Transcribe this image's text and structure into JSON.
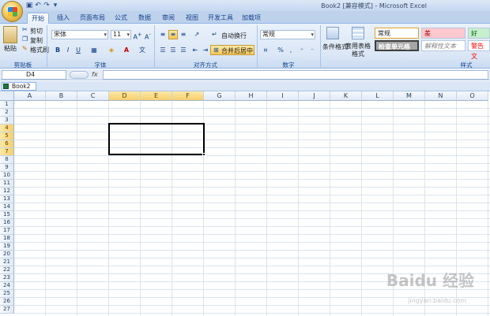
{
  "titlebar": {
    "title": "Book2  [兼容模式] - Microsoft Excel"
  },
  "tabs": [
    "开始",
    "插入",
    "页面布局",
    "公式",
    "数据",
    "审阅",
    "视图",
    "开发工具",
    "加载项"
  ],
  "clipboard": {
    "paste": "粘贴",
    "cut": "剪切",
    "copy": "复制",
    "format_painter": "格式刷",
    "group": "剪贴板"
  },
  "font": {
    "name": "宋体",
    "size": "11",
    "group": "字体",
    "bold": "B",
    "italic": "I",
    "underline": "U"
  },
  "alignment": {
    "wrap": "自动换行",
    "merge": "合并后居中",
    "group": "对齐方式"
  },
  "number": {
    "format": "常规",
    "percent": "%",
    "comma": ",",
    "group": "数字"
  },
  "styles": {
    "conditional": "条件格式",
    "table_format": "套用表格格式",
    "normal": "常规",
    "bad": "差",
    "good": "好",
    "check_cell": "检查单元格",
    "explanatory": "解释性文本",
    "warning": "警告文",
    "group": "样式"
  },
  "formula_bar": {
    "name_box": "D4",
    "fx": "fx",
    "content": ""
  },
  "workbook_tab": "Book2",
  "columns": [
    "A",
    "B",
    "C",
    "D",
    "E",
    "F",
    "G",
    "H",
    "I",
    "J",
    "K",
    "L",
    "M",
    "N",
    "O"
  ],
  "selected_columns": [
    "D",
    "E",
    "F"
  ],
  "rows": [
    "1",
    "2",
    "3",
    "4",
    "5",
    "6",
    "7",
    "8",
    "9",
    "10",
    "11",
    "12",
    "13",
    "14",
    "15",
    "16",
    "17",
    "18",
    "19",
    "20",
    "21",
    "22",
    "23",
    "24",
    "25",
    "26",
    "27"
  ],
  "selected_rows": [
    "4",
    "5",
    "6",
    "7"
  ],
  "watermark": {
    "main": "Baidu 经验",
    "sub": "jingyan.baidu.com"
  }
}
